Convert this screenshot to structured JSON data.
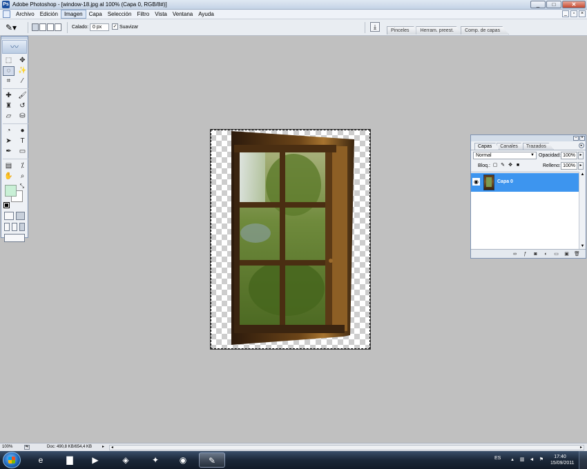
{
  "window": {
    "title": "Adobe Photoshop - [window-18.jpg al 100% (Capa 0, RGB/8#)]",
    "app_icon": "Ps",
    "controls": {
      "minimize": "_",
      "maximize": "□",
      "close": "✕"
    }
  },
  "menubar": {
    "items": [
      "Archivo",
      "Edición",
      "Imagen",
      "Capa",
      "Selección",
      "Filtro",
      "Vista",
      "Ventana",
      "Ayuda"
    ],
    "active_item": "Imagen",
    "doc_controls": {
      "minimize": "_",
      "restore": "▫",
      "close": "×"
    }
  },
  "options_bar": {
    "tool_icon": "lasso-icon",
    "tool_glyph": "✎▾",
    "feather_label": "Calado:",
    "feather_value": "0 px",
    "antialias_label": "Suavizar",
    "antialias_checked": true,
    "palette_well_tabs": [
      "Pinceles",
      "Herram. preest.",
      "Comp. de capas"
    ]
  },
  "toolbox": {
    "logo": "〰",
    "tools": [
      {
        "name": "marquee-icon",
        "glyph": "⬚"
      },
      {
        "name": "move-icon",
        "glyph": "✥"
      },
      {
        "name": "lasso-icon",
        "glyph": "◌",
        "selected": true
      },
      {
        "name": "magic-wand-icon",
        "glyph": "✨"
      },
      {
        "name": "crop-icon",
        "glyph": "⌗"
      },
      {
        "name": "slice-icon",
        "glyph": "⁄"
      },
      {
        "name": "healing-brush-icon",
        "glyph": "✚"
      },
      {
        "name": "brush-icon",
        "glyph": "🖌"
      },
      {
        "name": "clone-stamp-icon",
        "glyph": "♜"
      },
      {
        "name": "history-brush-icon",
        "glyph": "↺"
      },
      {
        "name": "eraser-icon",
        "glyph": "▱"
      },
      {
        "name": "paint-bucket-icon",
        "glyph": "⛁"
      },
      {
        "name": "blur-icon",
        "glyph": "◔"
      },
      {
        "name": "dodge-icon",
        "glyph": "●"
      },
      {
        "name": "path-selection-icon",
        "glyph": "➤"
      },
      {
        "name": "type-icon",
        "glyph": "T"
      },
      {
        "name": "pen-icon",
        "glyph": "✒"
      },
      {
        "name": "rectangle-shape-icon",
        "glyph": "▭"
      },
      {
        "name": "notes-icon",
        "glyph": "▤"
      },
      {
        "name": "eyedropper-icon",
        "glyph": "⁒"
      },
      {
        "name": "hand-icon",
        "glyph": "✋"
      },
      {
        "name": "zoom-icon",
        "glyph": "⌕"
      }
    ],
    "foreground_color": "#c9f0d6",
    "background_color": "#ffffff",
    "swap_glyph": "⤡"
  },
  "layers_panel": {
    "tabs": [
      "Capas",
      "Canales",
      "Trazados"
    ],
    "active_tab": "Capas",
    "blend_mode": "Normal",
    "opacity_label": "Opacidad:",
    "opacity_value": "100%",
    "lock_label": "Bloq.:",
    "fill_label": "Relleno:",
    "fill_value": "100%",
    "layers": [
      {
        "name": "Capa 0",
        "visible": true,
        "selected": true
      }
    ],
    "footer_icons": [
      "link-icon",
      "layer-style-icon",
      "mask-icon",
      "adjustment-layer-icon",
      "group-icon",
      "new-layer-icon",
      "trash-icon"
    ]
  },
  "status_bar": {
    "zoom": "100%",
    "doc_info": "Doc: 490,8 KB/654,4 KB"
  },
  "taskbar": {
    "apps": [
      {
        "name": "internet-explorer-icon",
        "glyph": "e",
        "open": false
      },
      {
        "name": "explorer-folder-icon",
        "glyph": "▇",
        "open": false
      },
      {
        "name": "media-player-icon",
        "glyph": "▶",
        "open": false
      },
      {
        "name": "app-icon-1",
        "glyph": "◈",
        "open": false
      },
      {
        "name": "app-icon-2",
        "glyph": "✦",
        "open": false
      },
      {
        "name": "chrome-icon",
        "glyph": "◉",
        "open": false
      },
      {
        "name": "photoshop-icon",
        "glyph": "✎",
        "open": true
      }
    ],
    "language": "ES",
    "time": "17:40",
    "date": "15/09/2011"
  },
  "colors": {
    "accent": "#3d95ef",
    "workspace": "#c0c0c0"
  }
}
